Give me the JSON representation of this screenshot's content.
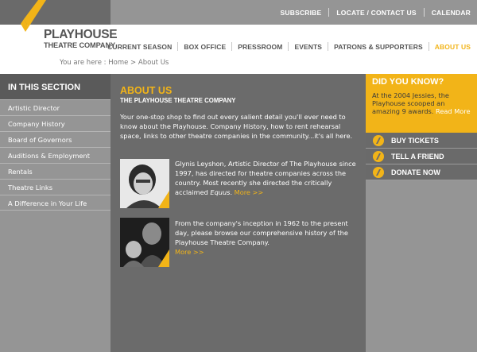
{
  "brand": {
    "line1": "PLAYHOUSE",
    "line2": "THEATRE COMPANY"
  },
  "utility_nav": [
    "SUBSCRIBE",
    "LOCATE / CONTACT US",
    "CALENDAR"
  ],
  "main_nav": {
    "items": [
      "CURRENT SEASON",
      "BOX OFFICE",
      "PRESSROOM",
      "EVENTS",
      "PATRONS & SUPPORTERS",
      "ABOUT US"
    ],
    "active": "ABOUT US"
  },
  "breadcrumb": {
    "prefix": "You are here :",
    "home": "Home",
    "sep": ">",
    "current": "About Us"
  },
  "sidebar": {
    "heading": "IN THIS SECTION",
    "items": [
      "Artistic Director",
      "Company History",
      "Board of Governors",
      "Auditions & Employment",
      "Rentals",
      "Theatre Links",
      "A Difference in Your Life"
    ]
  },
  "content": {
    "title": "ABOUT US",
    "subtitle": "THE PLAYHOUSE THEATRE COMPANY",
    "intro": "Your one-stop shop to find out every salient detail you'll ever need to know about the Playhouse. Company History, how to rent rehearsal space, links to other theatre companies in the community...it's all here.",
    "bio1_text": "Glynis Leyshon, Artistic Director of The Playhouse since 1997, has directed for theatre companies across the country. Most recently she directed the critically acclaimed",
    "bio1_em": "Equus",
    "bio1_end": ".",
    "bio1_more": "More >>",
    "bio2_text": "From the company's inception in 1962 to the present day, please browse our comprehensive history of the Playhouse Theatre Company.",
    "bio2_more": "More >>"
  },
  "did_you_know": {
    "title": "DID YOU KNOW?",
    "text": "At the 2004 Jessies, the Playhouse scooped an amazing 9 awards.",
    "link": "Read More"
  },
  "actions": [
    {
      "label": "BUY TICKETS",
      "icon": "ticket-icon"
    },
    {
      "label": "TELL A FRIEND",
      "icon": "friend-icon"
    },
    {
      "label": "DONATE NOW",
      "icon": "donate-icon"
    }
  ],
  "colors": {
    "accent": "#f2b418",
    "dark": "#6b6b6b",
    "mid": "#959595"
  }
}
